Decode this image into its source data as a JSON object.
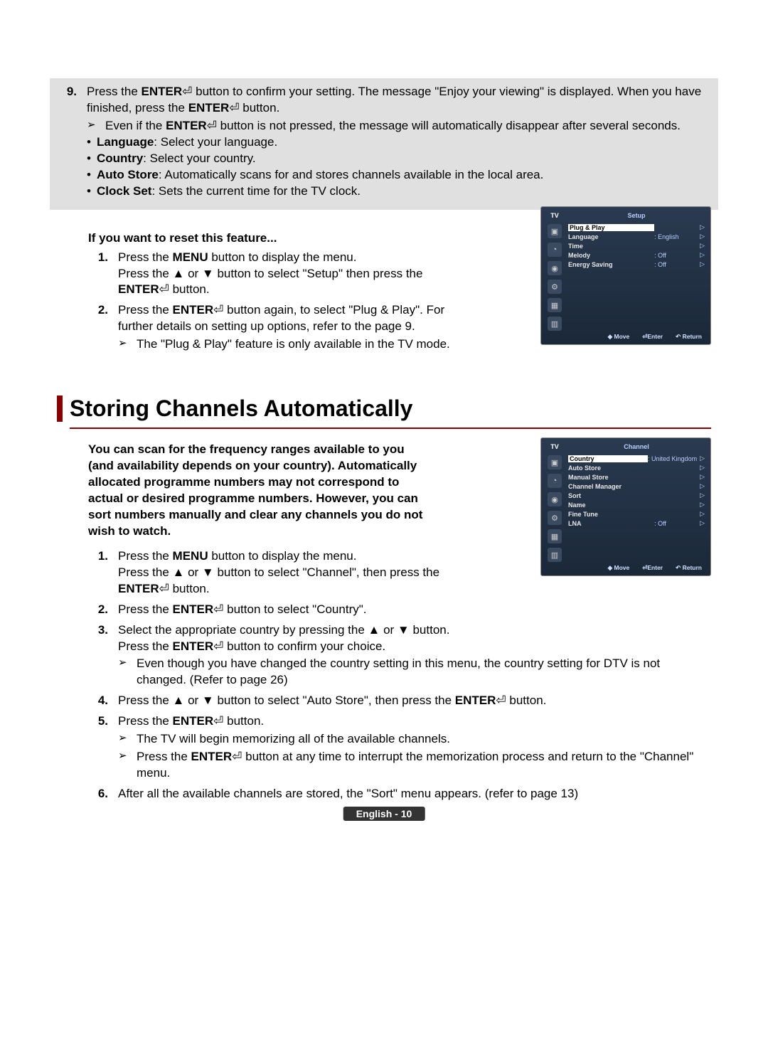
{
  "step9": {
    "num": "9.",
    "line1a": "Press the ",
    "enter": "ENTER",
    "line1b": " button to confirm your setting. The message \"Enjoy your viewing\" is displayed. When you have finished, press the ",
    "line1c": " button.",
    "note1": "Even if the ",
    "note1b": " button is not pressed, the message will automatically disappear after several seconds.",
    "b1_label": "Language",
    "b1_text": ": Select your language.",
    "b2_label": "Country",
    "b2_text": ": Select your country.",
    "b3_label": "Auto Store",
    "b3_text": ": Automatically scans for and stores channels available in the local area.",
    "b4_label": "Clock Set",
    "b4_text": ": Sets the current time for the TV clock."
  },
  "reset": {
    "heading": "If you want to reset this feature...",
    "s1_num": "1.",
    "s1_a": "Press the ",
    "menu": "MENU",
    "s1_b": " button to display the menu.",
    "s1_c": "Press the ▲ or ▼ button to select \"Setup\" then press the ",
    "s1_d": " button.",
    "s2_num": "2.",
    "s2_a": "Press the ",
    "s2_b": " button again, to select \"Plug & Play\". For further details on setting up options, refer to the page 9.",
    "s2_note": "The \"Plug & Play\" feature is only available in the TV mode."
  },
  "section_title": "Storing Channels Automatically",
  "intro": "You can scan for the frequency ranges available to you (and availability depends on your country). Automatically allocated programme numbers may not correspond to actual or desired programme numbers. However, you can sort numbers manually and clear any channels you do not wish to watch.",
  "steps": {
    "s1_num": "1.",
    "s1_a": "Press the ",
    "s1_b": " button to display the menu.",
    "s1_c": "Press the ▲ or ▼ button to select \"Channel\", then press the ",
    "s1_d": " button.",
    "s2_num": "2.",
    "s2_a": "Press the ",
    "s2_b": " button to select \"Country\".",
    "s3_num": "3.",
    "s3_a": "Select the appropriate country by pressing the ▲ or ▼ button.",
    "s3_b": "Press the ",
    "s3_c": " button to confirm your choice.",
    "s3_note": "Even though you have changed the country setting in this menu, the country setting for DTV is not changed. (Refer to page 26)",
    "s4_num": "4.",
    "s4_a": "Press the ▲ or ▼ button to select \"Auto Store\", then press the ",
    "s4_b": " button.",
    "s5_num": "5.",
    "s5_a": "Press the ",
    "s5_b": " button.",
    "s5_note1": "The TV will begin memorizing all of the available channels.",
    "s5_note2a": "Press the ",
    "s5_note2b": " button at any time to interrupt the memorization process and return to the \"Channel\" menu.",
    "s6_num": "6.",
    "s6_a": "After all the available channels are stored, the \"Sort\" menu appears. (refer to page 13)"
  },
  "osd1": {
    "tv": "TV",
    "title": "Setup",
    "rows": [
      {
        "lbl": "Plug & Play",
        "val": "",
        "sel": true
      },
      {
        "lbl": "Language",
        "val": ": English"
      },
      {
        "lbl": "Time",
        "val": ""
      },
      {
        "lbl": "Melody",
        "val": ": Off"
      },
      {
        "lbl": "Energy Saving",
        "val": ": Off"
      }
    ],
    "move": "Move",
    "enter": "Enter",
    "return": "Return"
  },
  "osd2": {
    "tv": "TV",
    "title": "Channel",
    "rows": [
      {
        "lbl": "Country",
        "val": ": United Kingdom",
        "sel": true
      },
      {
        "lbl": "Auto Store",
        "val": ""
      },
      {
        "lbl": "Manual Store",
        "val": ""
      },
      {
        "lbl": "Channel Manager",
        "val": ""
      },
      {
        "lbl": "Sort",
        "val": ""
      },
      {
        "lbl": "Name",
        "val": ""
      },
      {
        "lbl": "Fine Tune",
        "val": ""
      },
      {
        "lbl": "LNA",
        "val": ": Off"
      }
    ],
    "move": "Move",
    "enter": "Enter",
    "return": "Return"
  },
  "footer": "English - 10"
}
